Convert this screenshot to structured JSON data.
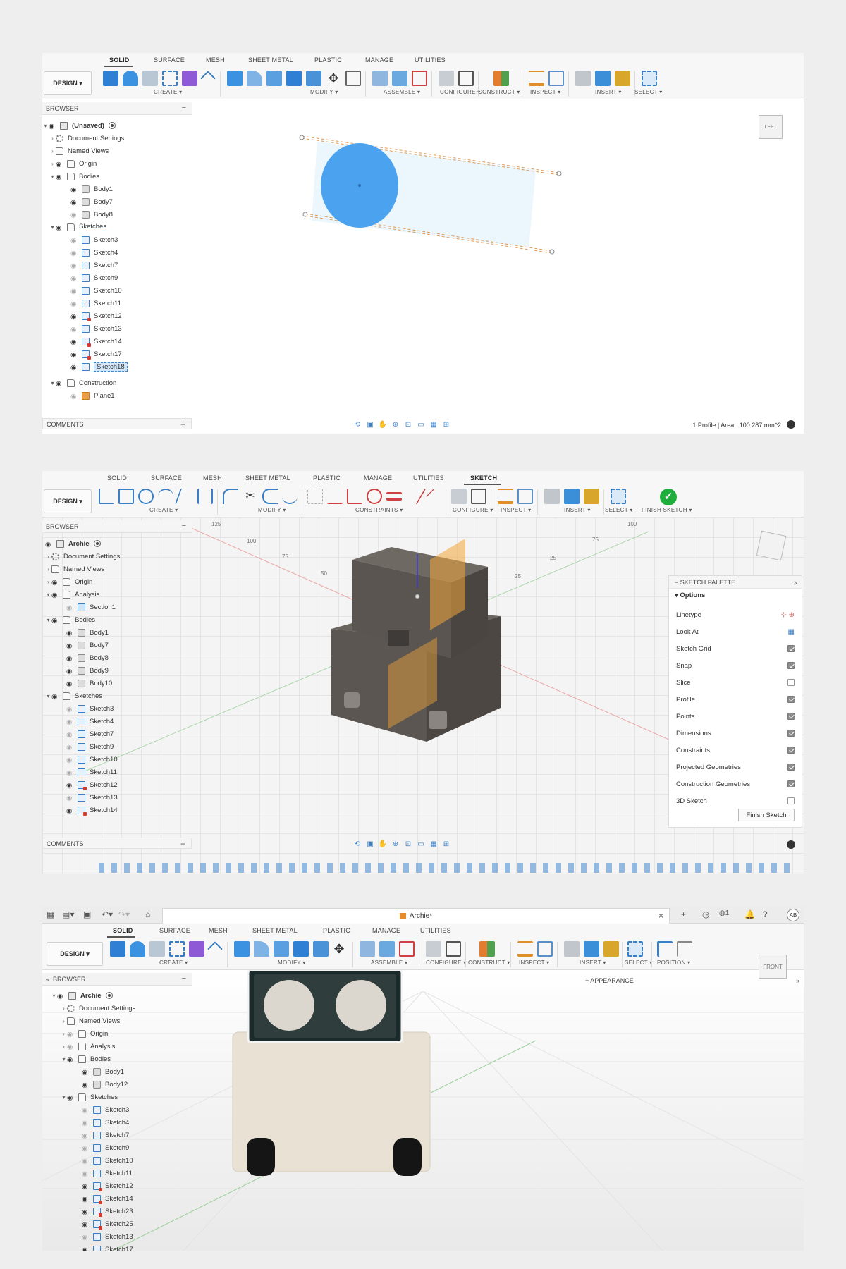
{
  "panel1": {
    "tabs": [
      "SOLID",
      "SURFACE",
      "MESH",
      "SHEET METAL",
      "PLASTIC",
      "MANAGE",
      "UTILITIES"
    ],
    "design": "DESIGN",
    "groups": [
      "CREATE",
      "MODIFY",
      "ASSEMBLE",
      "CONFIGURE",
      "CONSTRUCT",
      "INSPECT",
      "INSERT",
      "SELECT"
    ],
    "browser_title": "BROWSER",
    "root": "(Unsaved)",
    "tree": {
      "document_settings": "Document Settings",
      "named_views": "Named Views",
      "origin": "Origin",
      "bodies": "Bodies",
      "body1": "Body1",
      "body7": "Body7",
      "body8": "Body8",
      "sketches": "Sketches",
      "sketch_items": [
        "Sketch3",
        "Sketch4",
        "Sketch7",
        "Sketch9",
        "Sketch10",
        "Sketch11",
        "Sketch12",
        "Sketch13",
        "Sketch14",
        "Sketch17",
        "Sketch18"
      ],
      "construction": "Construction",
      "plane1": "Plane1"
    },
    "comments": "COMMENTS",
    "status": "1 Profile | Area : 100.287 mm^2",
    "viewcube": "LEFT"
  },
  "panel2": {
    "tabs": [
      "SOLID",
      "SURFACE",
      "MESH",
      "SHEET METAL",
      "PLASTIC",
      "MANAGE",
      "UTILITIES",
      "SKETCH"
    ],
    "design": "DESIGN",
    "groups": [
      "CREATE",
      "MODIFY",
      "CONSTRAINTS",
      "CONFIGURE",
      "INSPECT",
      "INSERT",
      "SELECT",
      "FINISH SKETCH"
    ],
    "browser_title": "BROWSER",
    "root": "Archie",
    "tree": {
      "document_settings": "Document Settings",
      "named_views": "Named Views",
      "origin": "Origin",
      "analysis": "Analysis",
      "section1": "Section1",
      "bodies": "Bodies",
      "body_items": [
        "Body1",
        "Body7",
        "Body8",
        "Body9",
        "Body10"
      ],
      "sketches": "Sketches",
      "sketch_items": [
        "Sketch3",
        "Sketch4",
        "Sketch7",
        "Sketch9",
        "Sketch10",
        "Sketch11",
        "Sketch12",
        "Sketch13",
        "Sketch14"
      ]
    },
    "palette": {
      "title": "SKETCH PALETTE",
      "options": "Options",
      "rows": [
        {
          "label": "Linetype",
          "checked": null
        },
        {
          "label": "Look At",
          "checked": null
        },
        {
          "label": "Sketch Grid",
          "checked": true
        },
        {
          "label": "Snap",
          "checked": true
        },
        {
          "label": "Slice",
          "checked": false
        },
        {
          "label": "Profile",
          "checked": true
        },
        {
          "label": "Points",
          "checked": true
        },
        {
          "label": "Dimensions",
          "checked": true
        },
        {
          "label": "Constraints",
          "checked": true
        },
        {
          "label": "Projected Geometries",
          "checked": true
        },
        {
          "label": "Construction Geometries",
          "checked": true
        },
        {
          "label": "3D Sketch",
          "checked": false
        }
      ],
      "finish": "Finish Sketch"
    },
    "comments": "COMMENTS",
    "rulers": [
      "125",
      "100",
      "75",
      "50",
      "25",
      "25",
      "75",
      "100"
    ]
  },
  "panel3": {
    "doc_title": "Archie*",
    "avatar": "AB",
    "notif_count": "1",
    "tabs": [
      "SOLID",
      "SURFACE",
      "MESH",
      "SHEET METAL",
      "PLASTIC",
      "MANAGE",
      "UTILITIES"
    ],
    "design": "DESIGN",
    "groups": [
      "CREATE",
      "MODIFY",
      "ASSEMBLE",
      "CONFIGURE",
      "CONSTRUCT",
      "INSPECT",
      "INSERT",
      "SELECT",
      "POSITION"
    ],
    "browser_title": "BROWSER",
    "root": "Archie",
    "tree": {
      "document_settings": "Document Settings",
      "named_views": "Named Views",
      "origin": "Origin",
      "analysis": "Analysis",
      "bodies": "Bodies",
      "body_items": [
        "Body1",
        "Body12"
      ],
      "sketches": "Sketches",
      "sketch_items": [
        "Sketch3",
        "Sketch4",
        "Sketch7",
        "Sketch9",
        "Sketch10",
        "Sketch11",
        "Sketch12",
        "Sketch14",
        "Sketch23",
        "Sketch25",
        "Sketch13",
        "Sketch17"
      ]
    },
    "appearance": "+ APPEARANCE",
    "viewcube": "FRONT"
  }
}
